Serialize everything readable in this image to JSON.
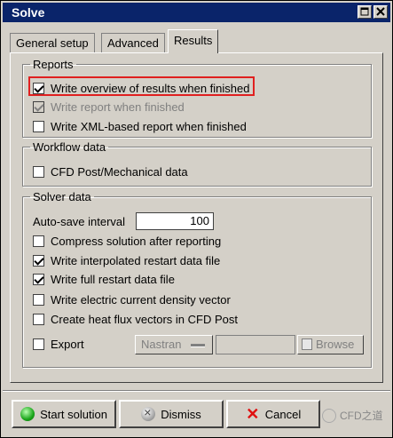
{
  "window": {
    "title": "Solve"
  },
  "tabs": [
    {
      "label": "General setup"
    },
    {
      "label": "Advanced"
    },
    {
      "label": "Results"
    }
  ],
  "reports": {
    "legend": "Reports",
    "items": [
      {
        "label": "Write overview of results when finished",
        "checked": true,
        "disabled": false
      },
      {
        "label": "Write report when finished",
        "checked": true,
        "disabled": true
      },
      {
        "label": "Write XML-based report when finished",
        "checked": false,
        "disabled": false
      }
    ]
  },
  "workflow": {
    "legend": "Workflow data",
    "items": [
      {
        "label": "CFD Post/Mechanical data",
        "checked": false
      }
    ]
  },
  "solver": {
    "legend": "Solver data",
    "autosave_label": "Auto-save interval",
    "autosave_value": "100",
    "items": [
      {
        "label": "Compress solution after reporting",
        "checked": false
      },
      {
        "label": "Write interpolated restart data file",
        "checked": true
      },
      {
        "label": "Write full restart data file",
        "checked": true
      },
      {
        "label": "Write electric current density vector",
        "checked": false
      },
      {
        "label": "Create heat flux vectors in CFD Post",
        "checked": false
      }
    ],
    "export_label": "Export",
    "export_format": "Nastran",
    "browse_label": "Browse"
  },
  "buttons": {
    "start": "Start solution",
    "dismiss": "Dismiss",
    "cancel": "Cancel"
  },
  "watermark": "CFD之道"
}
